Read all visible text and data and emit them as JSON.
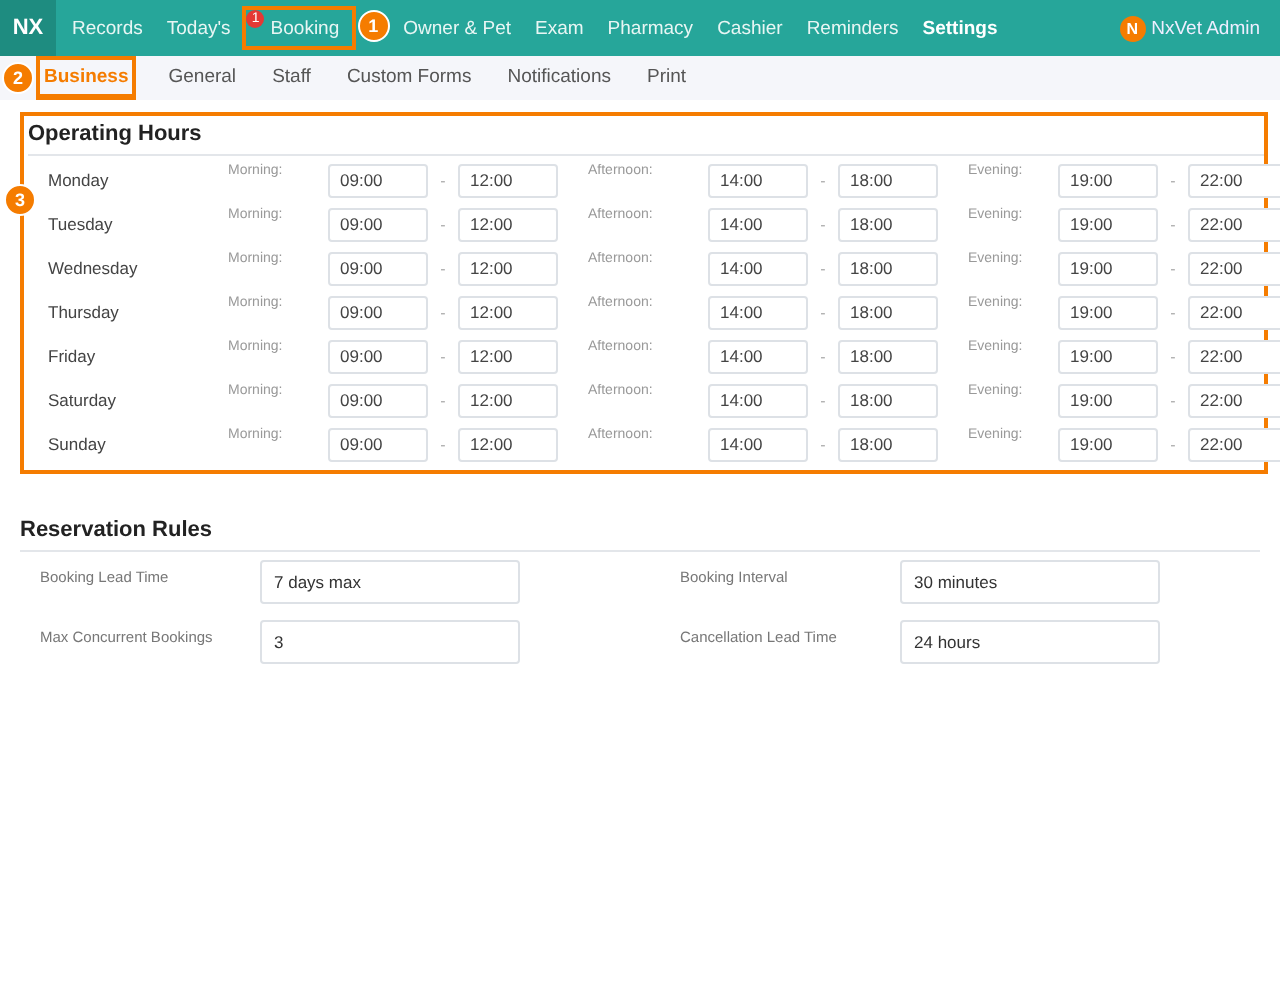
{
  "nav": {
    "logo": "NX",
    "items": [
      {
        "label": "Records",
        "selected": false
      },
      {
        "label": "Today's",
        "selected": false
      },
      {
        "label": "Booking",
        "selected": false,
        "badge": "1",
        "callout": "1"
      },
      {
        "label": "Owner & Pet",
        "selected": false
      },
      {
        "label": "Exam",
        "selected": false
      },
      {
        "label": "Pharmacy",
        "selected": false
      },
      {
        "label": "Cashier",
        "selected": false
      },
      {
        "label": "Reminders",
        "selected": false
      },
      {
        "label": "Settings",
        "selected": true
      }
    ],
    "user": {
      "initial": "N",
      "name": "NxVet Admin"
    }
  },
  "subtabs": [
    {
      "label": "Business",
      "selected": true,
      "callout": "2"
    },
    {
      "label": "General",
      "selected": false
    },
    {
      "label": "Staff",
      "selected": false
    },
    {
      "label": "Custom Forms",
      "selected": false
    },
    {
      "label": "Notifications",
      "selected": false
    },
    {
      "label": "Print",
      "selected": false
    }
  ],
  "operating_hours": {
    "title": "Operating Hours",
    "callout": "3",
    "days": [
      {
        "day": "Monday",
        "periods": [
          {
            "label": "Morning:",
            "from": "09:00",
            "to": "12:00"
          },
          {
            "label": "Afternoon:",
            "from": "14:00",
            "to": "18:00"
          },
          {
            "label": "Evening:",
            "from": "19:00",
            "to": "22:00"
          }
        ]
      },
      {
        "day": "Tuesday",
        "periods": [
          {
            "label": "Morning:",
            "from": "09:00",
            "to": "12:00"
          },
          {
            "label": "Afternoon:",
            "from": "14:00",
            "to": "18:00"
          },
          {
            "label": "Evening:",
            "from": "19:00",
            "to": "22:00"
          }
        ]
      },
      {
        "day": "Wednesday",
        "periods": [
          {
            "label": "Morning:",
            "from": "09:00",
            "to": "12:00"
          },
          {
            "label": "Afternoon:",
            "from": "14:00",
            "to": "18:00"
          },
          {
            "label": "Evening:",
            "from": "19:00",
            "to": "22:00"
          }
        ]
      },
      {
        "day": "Thursday",
        "periods": [
          {
            "label": "Morning:",
            "from": "09:00",
            "to": "12:00"
          },
          {
            "label": "Afternoon:",
            "from": "14:00",
            "to": "18:00"
          },
          {
            "label": "Evening:",
            "from": "19:00",
            "to": "22:00"
          }
        ]
      },
      {
        "day": "Friday",
        "periods": [
          {
            "label": "Morning:",
            "from": "09:00",
            "to": "12:00"
          },
          {
            "label": "Afternoon:",
            "from": "14:00",
            "to": "18:00"
          },
          {
            "label": "Evening:",
            "from": "19:00",
            "to": "22:00"
          }
        ]
      },
      {
        "day": "Saturday",
        "periods": [
          {
            "label": "Morning:",
            "from": "09:00",
            "to": "12:00"
          },
          {
            "label": "Afternoon:",
            "from": "14:00",
            "to": "18:00"
          },
          {
            "label": "Evening:",
            "from": "19:00",
            "to": "22:00"
          }
        ]
      },
      {
        "day": "Sunday",
        "periods": [
          {
            "label": "Morning:",
            "from": "09:00",
            "to": "12:00"
          },
          {
            "label": "Afternoon:",
            "from": "14:00",
            "to": "18:00"
          },
          {
            "label": "Evening:",
            "from": "19:00",
            "to": "22:00"
          }
        ]
      }
    ],
    "separator": "-"
  },
  "reservation_rules": {
    "title": "Reservation Rules",
    "fields": [
      {
        "label": "Booking Lead Time",
        "value": "7 days max"
      },
      {
        "label": "Booking Interval",
        "value": "30 minutes"
      },
      {
        "label": "Max Concurrent Bookings",
        "value": "3"
      },
      {
        "label": "Cancellation Lead Time",
        "value": "24 hours"
      }
    ]
  }
}
